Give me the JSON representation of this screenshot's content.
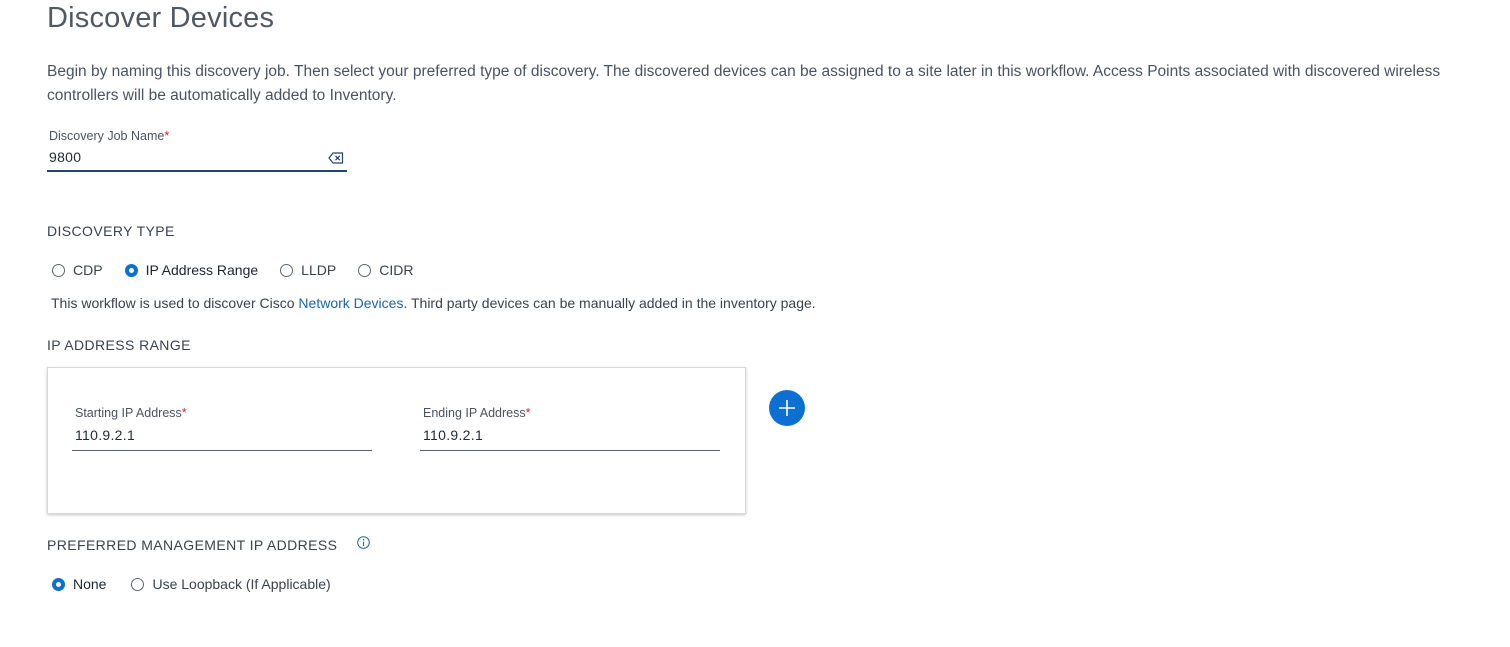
{
  "page": {
    "title": "Discover Devices",
    "description": "Begin by naming this discovery job. Then select your preferred type of discovery. The discovered devices can be assigned to a site later in this workflow. Access Points associated with discovered wireless controllers will be automatically added to Inventory."
  },
  "job_name": {
    "label": "Discovery Job Name",
    "required_mark": "*",
    "value": "9800",
    "clear_icon": "clear-input-icon"
  },
  "discovery_type": {
    "heading": "DISCOVERY TYPE",
    "options": [
      {
        "label": "CDP",
        "selected": false
      },
      {
        "label": "IP Address Range",
        "selected": true
      },
      {
        "label": "LLDP",
        "selected": false
      },
      {
        "label": "CIDR",
        "selected": false
      }
    ],
    "info_prefix": "This workflow is used to discover Cisco ",
    "info_link": "Network Devices",
    "info_suffix": ". Third party devices can be manually added in the inventory page."
  },
  "ip_range": {
    "heading": "IP ADDRESS RANGE",
    "start_label": "Starting IP Address",
    "start_value": "110.9.2.1",
    "end_label": "Ending IP Address",
    "end_value": "110.9.2.1",
    "required_mark": "*",
    "add_icon": "plus-icon"
  },
  "preferred_mgmt": {
    "heading": "PREFERRED MANAGEMENT IP ADDRESS",
    "info_icon": "info-icon",
    "options": [
      {
        "label": "None",
        "selected": true
      },
      {
        "label": "Use Loopback (If Applicable)",
        "selected": false
      }
    ]
  },
  "colors": {
    "accent": "#0d6fd1",
    "link": "#1a65a8",
    "required": "#cf2030",
    "focus_underline": "#1e4471"
  }
}
